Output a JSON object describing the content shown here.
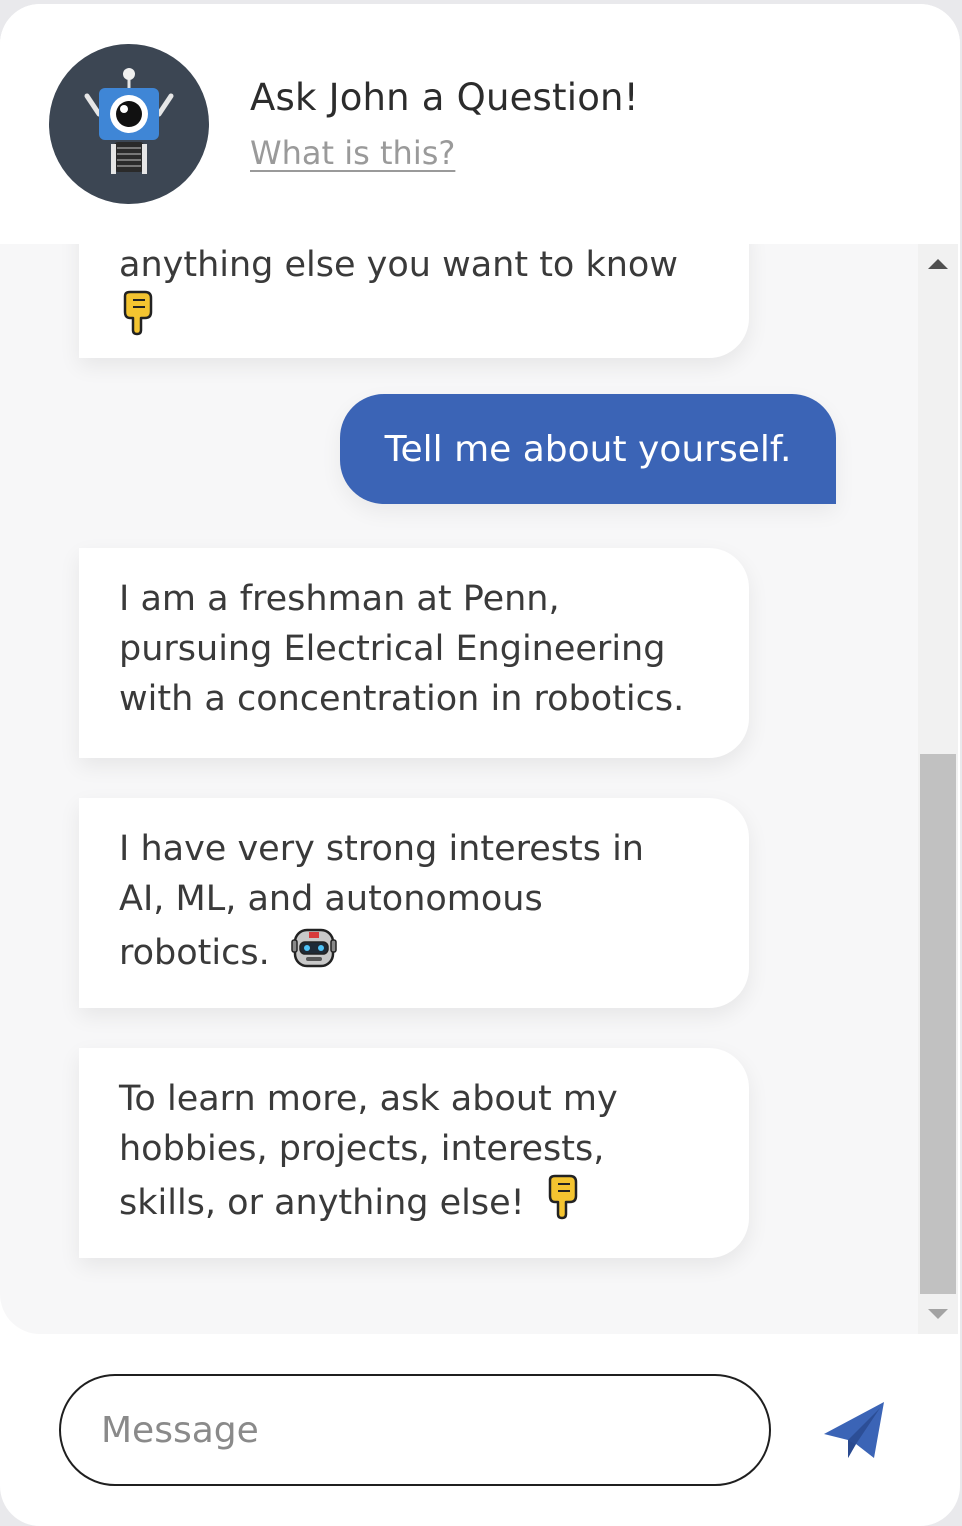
{
  "header": {
    "title": "Ask John a Question!",
    "subtitle_link": "What is this?",
    "avatar_icon": "robot-avatar-icon"
  },
  "messages": [
    {
      "sender": "bot",
      "text": "anything else you want to know",
      "emoji": "pointing-down-icon"
    },
    {
      "sender": "user",
      "text": "Tell me about yourself."
    },
    {
      "sender": "bot",
      "lines": [
        "I am a freshman at Penn,",
        "pursuing Electrical Engineering",
        "with a concentration in robotics."
      ]
    },
    {
      "sender": "bot",
      "lines": [
        "I have very strong interests in",
        "AI, ML, and autonomous",
        "robotics."
      ],
      "emoji": "robot-face-icon"
    },
    {
      "sender": "bot",
      "lines": [
        "To learn more, ask about my",
        "hobbies, projects, interests,",
        "skills, or anything else!"
      ],
      "emoji": "pointing-down-icon"
    }
  ],
  "composer": {
    "placeholder": "Message",
    "send_icon": "send-icon"
  },
  "colors": {
    "accent": "#3b64b6",
    "avatar_bg": "#3c4653",
    "chat_bg": "#f7f7f8"
  }
}
